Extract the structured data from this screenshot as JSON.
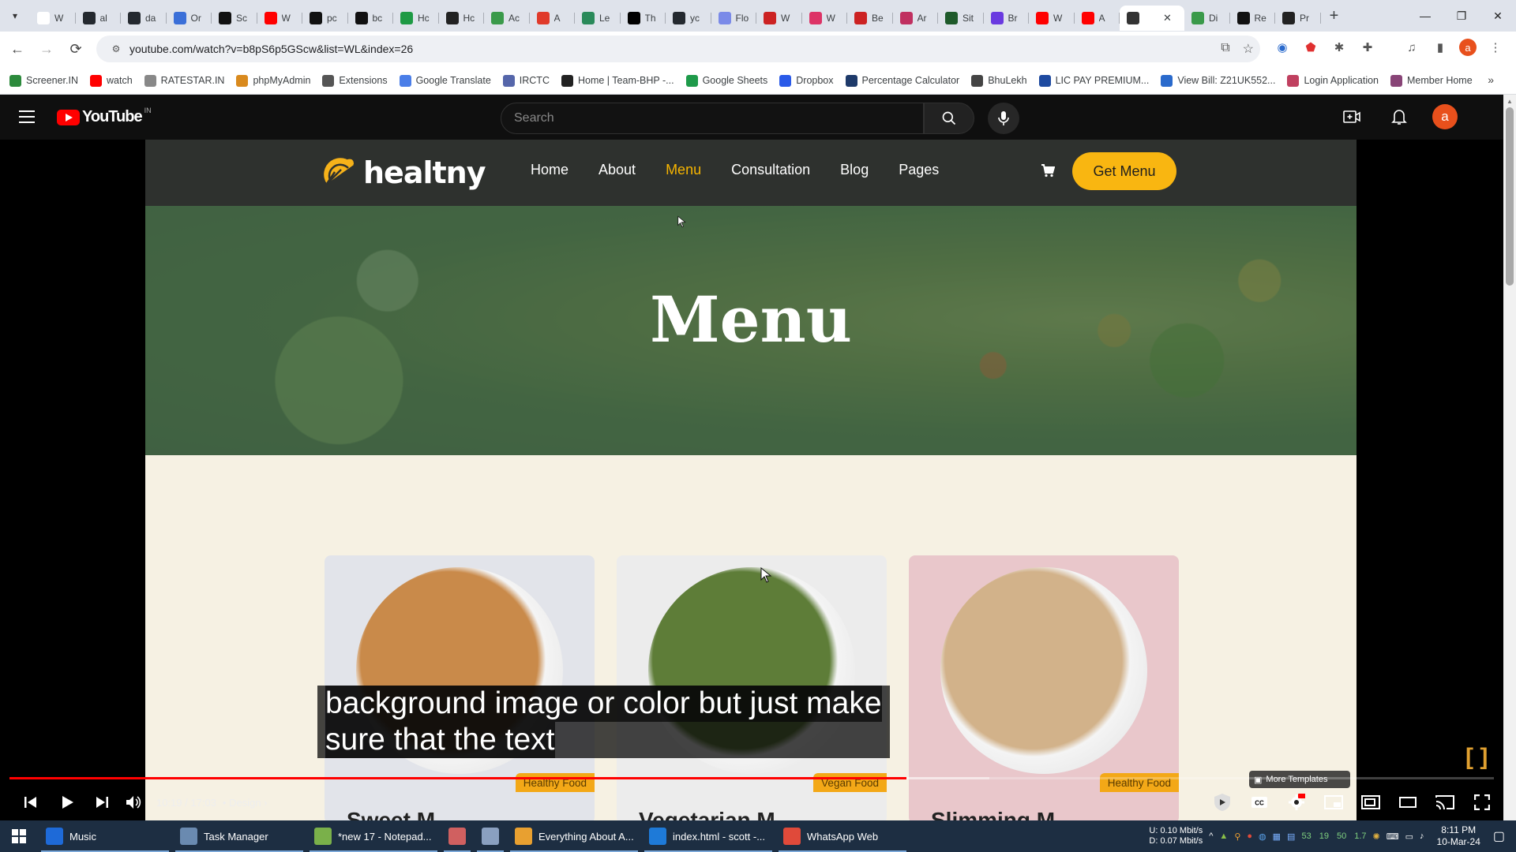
{
  "browser": {
    "tabs": [
      {
        "label": "W",
        "icon": "google-icon",
        "color": "#ffffff"
      },
      {
        "label": "al",
        "icon": "github-icon",
        "color": "#24292f"
      },
      {
        "label": "da",
        "icon": "github-icon",
        "color": "#24292f"
      },
      {
        "label": "Or",
        "icon": "circle-a-icon",
        "color": "#3a6fd8"
      },
      {
        "label": "Sc",
        "icon": "s-icon",
        "color": "#111111"
      },
      {
        "label": "W",
        "icon": "youtube-icon",
        "color": "#ff0000"
      },
      {
        "label": "pc",
        "icon": "medium-icon",
        "color": "#111111"
      },
      {
        "label": "bc",
        "icon": "medium-icon",
        "color": "#111111"
      },
      {
        "label": "Hc",
        "icon": "w-icon",
        "color": "#1e9a44"
      },
      {
        "label": "Hc",
        "icon": "a-icon",
        "color": "#222222"
      },
      {
        "label": "Ac",
        "icon": "link-icon",
        "color": "#3a9a4a"
      },
      {
        "label": "A",
        "icon": "asterisk-icon",
        "color": "#e03a2a"
      },
      {
        "label": "Le",
        "icon": "leaf-icon",
        "color": "#2a8a5a"
      },
      {
        "label": "Th",
        "icon": "dev-icon",
        "color": "#000000"
      },
      {
        "label": "yc",
        "icon": "github-icon",
        "color": "#24292f"
      },
      {
        "label": "Flo",
        "icon": "swirl-icon",
        "color": "#7a8ae8"
      },
      {
        "label": "W",
        "icon": "nn-icon",
        "color": "#cc2222"
      },
      {
        "label": "W",
        "icon": "circle-icon",
        "color": "#dd3366"
      },
      {
        "label": "Be",
        "icon": "nn-icon",
        "color": "#cc2222"
      },
      {
        "label": "Ar",
        "icon": "heart-icon",
        "color": "#c03060"
      },
      {
        "label": "Sit",
        "icon": "n-icon",
        "color": "#1e5a2a"
      },
      {
        "label": "Br",
        "icon": "b-icon",
        "color": "#6a3ae0"
      },
      {
        "label": "W",
        "icon": "youtube-icon",
        "color": "#ff0000"
      },
      {
        "label": "A",
        "icon": "youtube-icon",
        "color": "#ff0000"
      },
      {
        "label": "",
        "icon": "speaker-icon",
        "color": "#333333",
        "active": true
      },
      {
        "label": "Di",
        "icon": "link-icon",
        "color": "#3a9a4a"
      },
      {
        "label": "Re",
        "icon": "medium-icon",
        "color": "#111111"
      },
      {
        "label": "Pr",
        "icon": "box-icon",
        "color": "#222222"
      }
    ],
    "url": "youtube.com/watch?v=b8pS6p5GScw&list=WL&index=26",
    "bookmarks": [
      {
        "label": "Screener.IN",
        "color": "#2c8a3c"
      },
      {
        "label": "watch",
        "color": "#ff0000"
      },
      {
        "label": "RATESTAR.IN",
        "color": "#888888"
      },
      {
        "label": "phpMyAdmin",
        "color": "#d98a1e"
      },
      {
        "label": "Extensions",
        "color": "#555555"
      },
      {
        "label": "Google Translate",
        "color": "#4a7ee8"
      },
      {
        "label": "IRCTC",
        "color": "#5566aa"
      },
      {
        "label": "Home | Team-BHP -...",
        "color": "#222222"
      },
      {
        "label": "Google Sheets",
        "color": "#1e9a4a"
      },
      {
        "label": "Dropbox",
        "color": "#2a5ae8"
      },
      {
        "label": "Percentage Calculator",
        "color": "#1e3a6a"
      },
      {
        "label": "BhuLekh",
        "color": "#444444"
      },
      {
        "label": "LIC PAY PREMIUM...",
        "color": "#1e4aa0"
      },
      {
        "label": "View Bill: Z21UK552...",
        "color": "#2a6acc"
      },
      {
        "label": "Login Application",
        "color": "#c04060"
      },
      {
        "label": "Member Home",
        "color": "#884477"
      }
    ]
  },
  "youtube": {
    "logo_word": "YouTube",
    "region": "IN",
    "search_placeholder": "Search",
    "avatar_letter": "a"
  },
  "site": {
    "brand": "healtny",
    "nav": [
      {
        "label": "Home"
      },
      {
        "label": "About"
      },
      {
        "label": "Menu",
        "active": true
      },
      {
        "label": "Consultation"
      },
      {
        "label": "Blog"
      },
      {
        "label": "Pages"
      }
    ],
    "cta": "Get Menu",
    "hero_title": "Menu",
    "cards": [
      {
        "tag": "Healthy Food",
        "name": "Sweet M",
        "bg": "#e2e4ea",
        "bowl": "#c98a4a"
      },
      {
        "tag": "Vegan Food",
        "name": "Vegetarian M",
        "bg": "#ececec",
        "bowl": "#5e7d38"
      },
      {
        "tag": "Healthy Food",
        "name": "Slimming M",
        "bg": "#e9c7cb",
        "bowl": "#d2b28a"
      }
    ]
  },
  "player": {
    "subtitle_line1": "background image or color but just make",
    "subtitle_line2": "sure that the text",
    "time": "10:19 / 17:03",
    "chapter": "Design",
    "more_templates": "More Templates",
    "progress": 0.604,
    "buffered": 0.66
  },
  "taskbar": {
    "apps": [
      {
        "label": "Music",
        "color": "#1e6ad8"
      },
      {
        "label": "Task Manager",
        "color": "#6a8ab0"
      },
      {
        "label": "*new 17 - Notepad...",
        "color": "#7ab04a"
      },
      {
        "label": "",
        "color": "#d06060"
      },
      {
        "label": "",
        "color": "#8aa0c0"
      },
      {
        "label": "Everything About A...",
        "color": "#e8a030"
      },
      {
        "label": "index.html - scott -...",
        "color": "#1e7ad8"
      },
      {
        "label": "WhatsApp Web",
        "color": "#e04a3a"
      }
    ],
    "net_up": "0.10 Mbit/s",
    "net_down": "0.07 Mbit/s",
    "net_u": "U:",
    "net_d": "D:",
    "tray_nums": [
      "53",
      "19",
      "50",
      "1.7"
    ],
    "time": "8:11 PM",
    "date": "10-Mar-24"
  }
}
